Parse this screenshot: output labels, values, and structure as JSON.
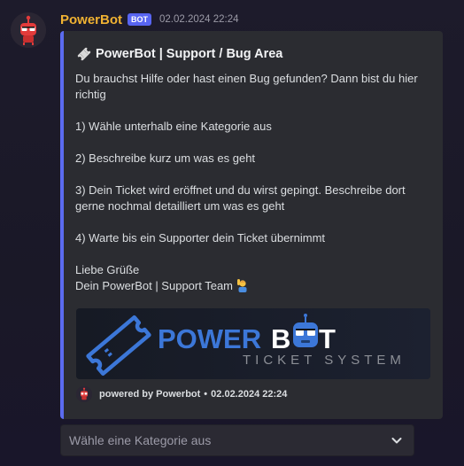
{
  "message": {
    "username": "PowerBot",
    "bot_tag": "BOT",
    "timestamp": "02.02.2024 22:24"
  },
  "embed": {
    "title": "PowerBot | Support / Bug Area",
    "description": "Du brauchst Hilfe oder hast einen Bug gefunden? Dann bist du hier richtig\n\n1) Wähle unterhalb eine Kategorie aus\n\n2) Beschreibe kurz um was es geht\n\n3) Dein Ticket wird eröffnet und du wirst gepingt. Beschreibe dort gerne nochmal detailliert um was es geht\n\n4) Warte bis ein Supporter dein Ticket übernimmt\n\nLiebe Grüße\nDein PowerBot | Support Team",
    "accent_color": "#5b6bf0",
    "banner": {
      "word_power": "POWER",
      "word_b": "B",
      "word_t": "T",
      "subtitle": "TICKET SYSTEM"
    },
    "footer": {
      "text": "powered by Powerbot",
      "separator": "•",
      "timestamp": "02.02.2024 22:24"
    }
  },
  "select_menu": {
    "placeholder": "Wähle eine Kategorie aus",
    "icon": "chevron-down-icon"
  },
  "colors": {
    "username": "#f0b232",
    "bot_tag": "#5865f2",
    "embed_bg": "#2b2c31"
  }
}
